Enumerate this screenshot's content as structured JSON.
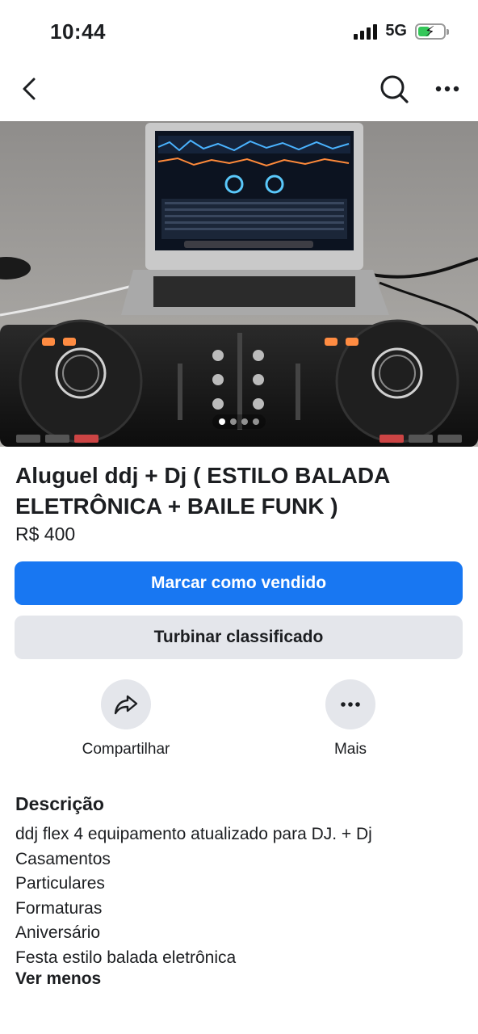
{
  "status_bar": {
    "time": "10:44",
    "network": "5G",
    "battery_level": 0.45,
    "battery_color": "#34c759"
  },
  "nav": {
    "back_icon": "chevron-left-icon",
    "search_icon": "search-icon",
    "more_icon": "more-horizontal-icon"
  },
  "gallery": {
    "image_count": 4,
    "current_index": 1,
    "image_description_icon": "photo"
  },
  "listing": {
    "title": "Aluguel ddj + Dj ( ESTILO BALADA ELETRÔNICA + BAILE FUNK )",
    "price": "R$ 400"
  },
  "buttons": {
    "mark_sold": "Marcar como vendido",
    "boost": "Turbinar classificado",
    "primary_color": "#1877f2",
    "secondary_color": "#e4e6eb"
  },
  "actions": {
    "share_label": "Compartilhar",
    "more_label": "Mais"
  },
  "description": {
    "heading": "Descrição",
    "lines": [
      "ddj flex 4 equipamento atualizado para DJ. + Dj",
      "Casamentos",
      "Particulares",
      "Formaturas",
      "Aniversário",
      "Festa estilo balada eletrônica"
    ],
    "toggle_label": "Ver menos"
  }
}
